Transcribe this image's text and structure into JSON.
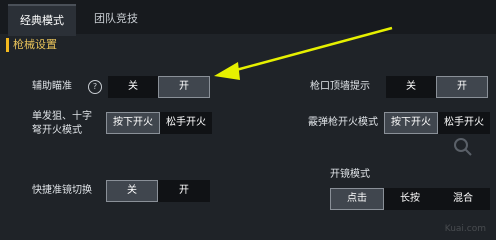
{
  "tabs": [
    {
      "label": "经典模式"
    },
    {
      "label": "团队竞技"
    }
  ],
  "section": {
    "title": "枪械设置"
  },
  "aim_assist": {
    "label": "辅助瞄准",
    "help": "?",
    "off": "关",
    "on": "开"
  },
  "muzzle_hint": {
    "label": "枪口顶墙提示",
    "off": "关",
    "on": "开"
  },
  "single_fire": {
    "label_line1": "单发狙、十字",
    "label_line2": "弩开火模式",
    "press": "按下开火",
    "release": "松手开火"
  },
  "shotgun_fire": {
    "label": "霰弹枪开火模式",
    "press": "按下开火",
    "release": "松手开火"
  },
  "quick_scope": {
    "label": "快捷准镜切换",
    "off": "关",
    "on": "开"
  },
  "scope_mode": {
    "label": "开镜模式",
    "tap": "点击",
    "hold": "长按",
    "mixed": "混合"
  },
  "watermark": "Kuai.com",
  "colors": {
    "accent": "#f2b81f",
    "arrow": "#e6f000",
    "background": "#1f2328"
  }
}
